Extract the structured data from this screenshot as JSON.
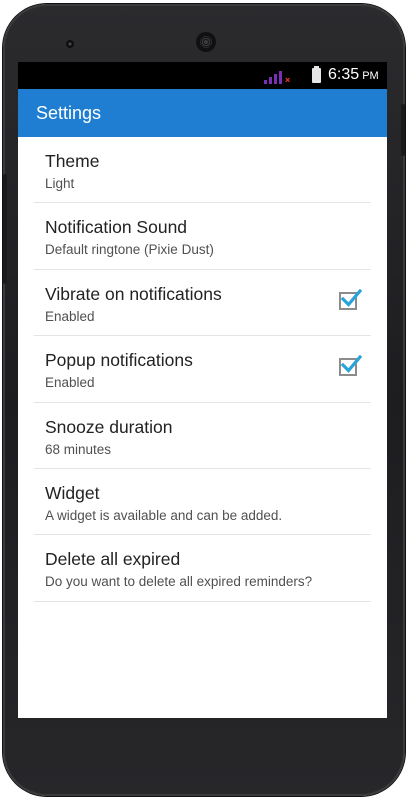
{
  "status_bar": {
    "time": "6:35",
    "ampm": "PM",
    "signal_icon": "signal-bars-icon",
    "battery_icon": "battery-icon",
    "colors": {
      "signal": "#7b2fb6",
      "no_data": "#ff3b30"
    }
  },
  "app_bar": {
    "title": "Settings",
    "color": "#1f7ed1"
  },
  "settings": [
    {
      "title": "Theme",
      "summary": "Light",
      "checkbox": null
    },
    {
      "title": "Notification Sound",
      "summary": "Default ringtone (Pixie Dust)",
      "checkbox": null
    },
    {
      "title": "Vibrate on notifications",
      "summary": "Enabled",
      "checkbox": true
    },
    {
      "title": "Popup notifications",
      "summary": "Enabled",
      "checkbox": true
    },
    {
      "title": "Snooze duration",
      "summary": "68 minutes",
      "checkbox": null
    },
    {
      "title": "Widget",
      "summary": "A widget is available and can be added.",
      "checkbox": null
    },
    {
      "title": "Delete all expired",
      "summary": "Do you want to delete all expired reminders?",
      "checkbox": null
    }
  ],
  "check_color": "#2aa3d9"
}
